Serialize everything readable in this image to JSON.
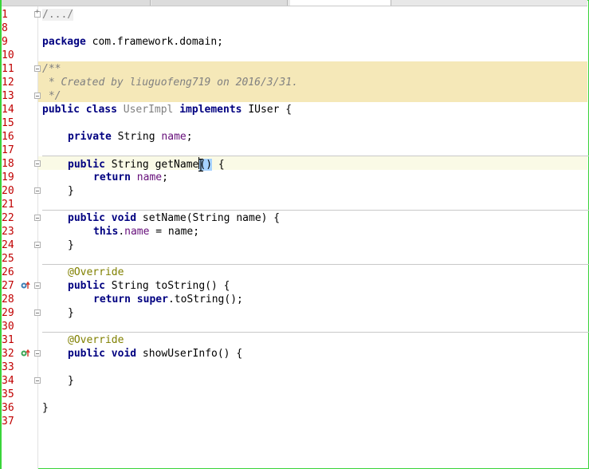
{
  "tabs": [
    {
      "label": ""
    },
    {
      "label": ""
    },
    {
      "label": ""
    }
  ],
  "colors": {
    "line_number": "#c00000",
    "keyword": "#000080",
    "field": "#660e7a",
    "annotation": "#808000",
    "doc_comment": "#808080",
    "doc_background": "#f5e8b8",
    "window_border": "#39d439"
  },
  "line_numbers": [
    "1",
    "8",
    "9",
    "10",
    "11",
    "12",
    "13",
    "14",
    "15",
    "16",
    "17",
    "18",
    "19",
    "20",
    "21",
    "22",
    "23",
    "24",
    "25",
    "26",
    "27",
    "28",
    "29",
    "30",
    "31",
    "32",
    "33",
    "34",
    "35",
    "36",
    "37"
  ],
  "code": {
    "l1_fold": "/.../",
    "l9_package_kw": "package",
    "l9_package_name": " com.framework.domain;",
    "l11_doc": "/**",
    "l12_doc_prefix": " * Created by ",
    "l12_doc_author": "liuguofeng719",
    "l12_doc_suffix": " on 2016/3/31.",
    "l13_doc": " */",
    "l14_public": "public",
    "l14_class": "class",
    "l14_name": "UserImpl",
    "l14_implements": "implements",
    "l14_iface": " IUser {",
    "l16_private": "private",
    "l16_type": " String ",
    "l16_field": "name",
    "l16_end": ";",
    "l18_public": "public",
    "l18_sig_a": " String getNam",
    "l18_sig_b": "e",
    "l18_sig_c": "()",
    "l18_sig_d": " {",
    "l19_return": "return",
    "l19_field": "name",
    "l19_end": ";",
    "l20": "}",
    "l22_public": "public",
    "l22_void": "void",
    "l22_sig": " setName(String name) {",
    "l23_this": "this",
    "l23_dot": ".",
    "l23_field": "name",
    "l23_rest": " = name;",
    "l24": "}",
    "l26_ann": "@Override",
    "l27_public": "public",
    "l27_sig": " String toString() {",
    "l28_return": "return",
    "l28_super": "super",
    "l28_rest": ".toString();",
    "l29": "}",
    "l31_ann": "@Override",
    "l32_public": "public",
    "l32_void": "void",
    "l32_sig": " showUserInfo() {",
    "l34": "}",
    "l36": "}"
  }
}
